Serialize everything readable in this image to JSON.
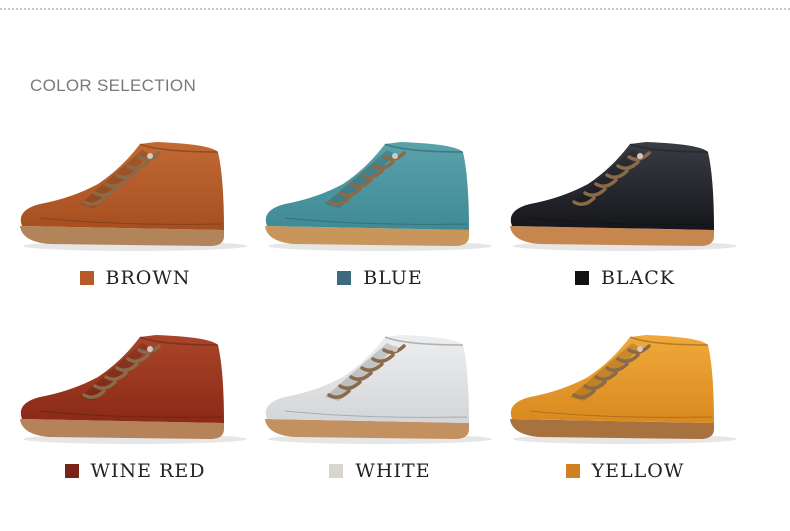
{
  "header": {
    "title": "COLOR SELECTION"
  },
  "colors": [
    {
      "label": "BROWN",
      "swatch": "#b85a26",
      "body": "#a64e1f",
      "light": "#c26a35",
      "sole": "#b2845a"
    },
    {
      "label": "BLUE",
      "swatch": "#3e6a80",
      "body": "#3f8a96",
      "light": "#5aa2ab",
      "sole": "#c8955a"
    },
    {
      "label": "BLACK",
      "swatch": "#111111",
      "body": "#15161a",
      "light": "#3a3c44",
      "sole": "#c7864e"
    },
    {
      "label": "WINE RED",
      "swatch": "#7a2418",
      "body": "#8a2a16",
      "light": "#a9452a",
      "sole": "#b5825a"
    },
    {
      "label": "WHITE",
      "swatch": "#d8d4cf",
      "body": "#d3d5d8",
      "light": "#eceeef",
      "sole": "#c39060"
    },
    {
      "label": "YELLOW",
      "swatch": "#d08020",
      "body": "#d9891f",
      "light": "#f0a93a",
      "sole": "#a8723e"
    }
  ]
}
